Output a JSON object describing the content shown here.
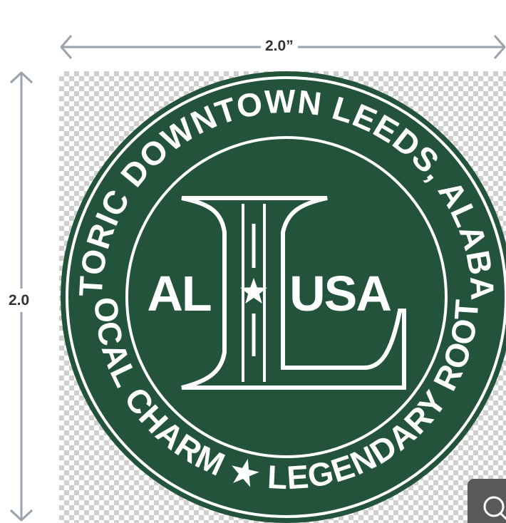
{
  "dimensions": {
    "width_label": "2.0”",
    "height_label": "2.0"
  },
  "logo": {
    "top_text": "HISTORIC DOWNTOWN LEEDS, ALABAMA",
    "bottom_text": "LOCAL CHARM ★ LEGENDARY ROOTS",
    "monogram": "L",
    "left_text": "AL",
    "right_text": "USA",
    "colors": {
      "badge_green": "#23533a",
      "badge_line": "#ffffff"
    }
  },
  "icons": {
    "arrow_left": "arrow-left-icon",
    "arrow_right": "arrow-right-icon",
    "arrow_up": "arrow-up-icon",
    "arrow_down": "arrow-down-icon",
    "star": "star-icon",
    "zoom": "zoom-icon"
  },
  "colors": {
    "dimension_line": "#9aa3ad",
    "label_text": "#333333",
    "checker": "#cfcfcf",
    "control_bg": "#595959"
  }
}
